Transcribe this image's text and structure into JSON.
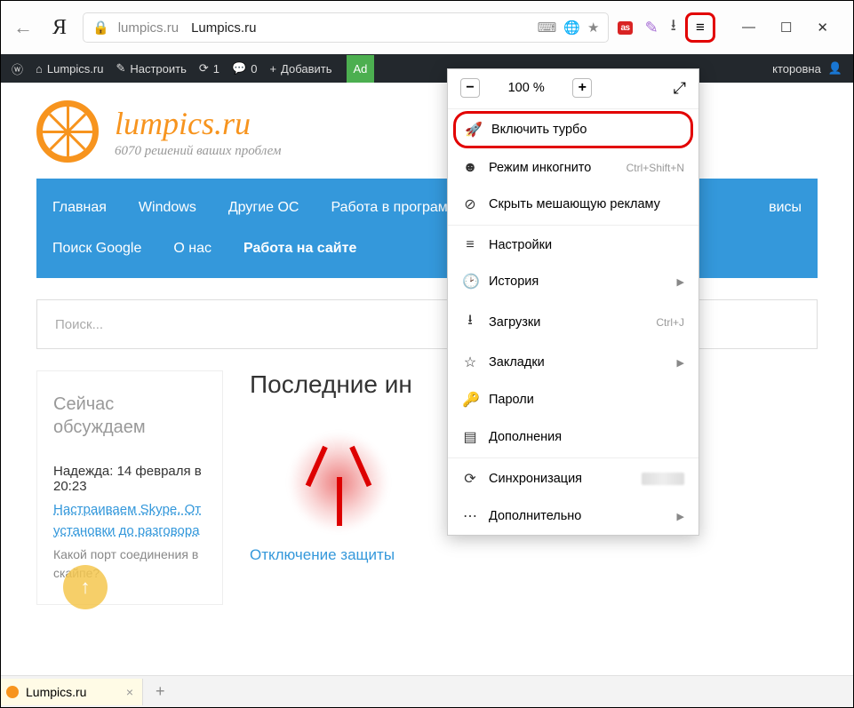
{
  "chrome": {
    "address_domain": "lumpics.ru",
    "address_title": "Lumpics.ru"
  },
  "win": {
    "min": "—",
    "max": "☐",
    "close": "✕"
  },
  "wp": {
    "site": "Lumpics.ru",
    "customize": "Настроить",
    "updates": "1",
    "comments": "0",
    "add": "Добавить",
    "ad": "Ad",
    "user_suffix": "кторовна"
  },
  "site": {
    "title": "lumpics.ru",
    "tagline": "6070 решений ваших проблем"
  },
  "nav": [
    "Главная",
    "Windows",
    "Другие ОС",
    "Работа в программах",
    "висы",
    "Поиск Google",
    "О нас",
    "Работа на сайте"
  ],
  "search_placeholder": "Поиск...",
  "sidebar": {
    "heading": "Сейчас обсуждаем",
    "meta": "Надежда: 14 февраля в 20:23",
    "link": "Настраиваем Skype. От установки до разговора",
    "body": "Какой порт соединения в скайпе?"
  },
  "main": {
    "heading_partial": "Последние ин",
    "card1": "Отключение защиты"
  },
  "menu": {
    "zoom": "100 %",
    "turbo": "Включить турбо",
    "incognito": "Режим инкогнито",
    "incognito_key": "Ctrl+Shift+N",
    "hide_ads": "Скрыть мешающую рекламу",
    "settings": "Настройки",
    "history": "История",
    "downloads": "Загрузки",
    "downloads_key": "Ctrl+J",
    "bookmarks": "Закладки",
    "passwords": "Пароли",
    "addons": "Дополнения",
    "sync": "Синхронизация",
    "more": "Дополнительно"
  },
  "tab": {
    "title": "Lumpics.ru"
  }
}
